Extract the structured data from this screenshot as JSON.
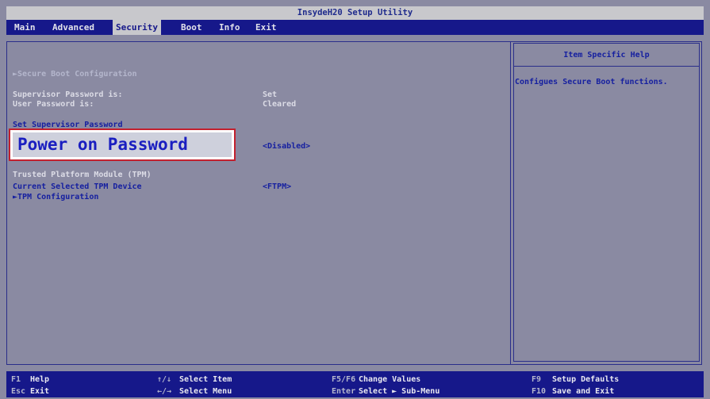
{
  "window": {
    "title": "InsydeH20 Setup Utility"
  },
  "menu": [
    {
      "label": "Main",
      "active": false
    },
    {
      "label": "Advanced",
      "active": false
    },
    {
      "label": "Security",
      "active": true
    },
    {
      "label": "Boot",
      "active": false
    },
    {
      "label": "Info",
      "active": false
    },
    {
      "label": "Exit",
      "active": false
    }
  ],
  "main": {
    "secure_boot_config": "►Secure Boot Configuration",
    "supervisor_password_label": "Supervisor Password is:",
    "supervisor_password_value": "Set",
    "user_password_label": "User Password is:",
    "user_password_value": "Cleared",
    "set_supervisor_password": "Set Supervisor Password",
    "power_on_password_label": "Power on Password",
    "power_on_password_value": "<Disabled>",
    "tpm_heading": "Trusted Platform Module (TPM)",
    "current_tpm_label": "Current Selected TPM Device",
    "current_tpm_value": "<FTPM>",
    "tpm_configuration": "►TPM Configuration"
  },
  "help": {
    "title": "Item Specific Help",
    "text": "Configues Secure Boot functions."
  },
  "footer": {
    "items": [
      {
        "key": "F1",
        "label": "Help"
      },
      {
        "key": "Esc",
        "label": "Exit"
      },
      {
        "key": "↑/↓",
        "label": "Select Item"
      },
      {
        "key": "←/→",
        "label": "Select Menu"
      },
      {
        "key": "F5/F6",
        "label": "Change Values"
      },
      {
        "key": "Enter",
        "label": "Select ► Sub-Menu"
      },
      {
        "key": "F9",
        "label": "Setup Defaults"
      },
      {
        "key": "F10",
        "label": "Save and Exit"
      }
    ]
  },
  "colors": {
    "background": "#8a8aa2",
    "menubar": "#16188a",
    "selected_text": "#1a1ec0",
    "highlight_border": "#c2202e"
  }
}
